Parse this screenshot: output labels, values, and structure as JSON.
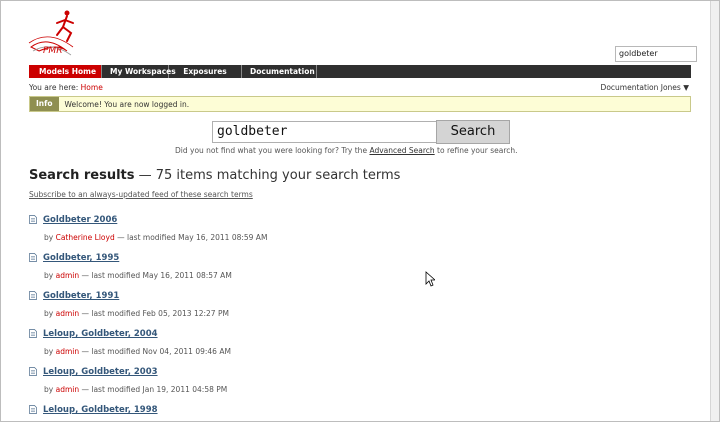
{
  "header": {
    "search_value": "goldbeter",
    "nav_tabs": [
      {
        "label": "Models Home",
        "active": true
      },
      {
        "label": "My Workspaces",
        "active": false
      },
      {
        "label": "Exposures",
        "active": false
      },
      {
        "label": "Documentation",
        "active": false
      }
    ],
    "breadcrumb_prefix": "You are here:",
    "breadcrumb_home": "Home",
    "user_name": "Documentation Jones",
    "user_menu_icon": "caret-down-icon"
  },
  "info": {
    "label": "Info",
    "message": "Welcome! You are now logged in."
  },
  "search": {
    "input_value": "goldbeter",
    "button_label": "Search",
    "hint_prefix": "Did you not find what you were looking for? Try the",
    "hint_link": "Advanced Search",
    "hint_suffix": "to refine your search."
  },
  "results": {
    "heading_bold": "Search results",
    "heading_rest": "— 75 items matching your search terms",
    "subscribe_link": "Subscribe to an always-updated feed of these search terms",
    "by_label": "by",
    "modified_label": "— last modified",
    "items": [
      {
        "title": "Goldbeter 2006",
        "author": "Catherine Lloyd",
        "modified": "May 16, 2011 08:59 AM"
      },
      {
        "title": "Goldbeter, 1995",
        "author": "admin",
        "modified": "May 16, 2011 08:57 AM"
      },
      {
        "title": "Goldbeter, 1991",
        "author": "admin",
        "modified": "Feb 05, 2013 12:27 PM"
      },
      {
        "title": "Leloup, Goldbeter, 2004",
        "author": "admin",
        "modified": "Nov 04, 2011 09:46 AM"
      },
      {
        "title": "Leloup, Goldbeter, 2003",
        "author": "admin",
        "modified": "Jan 19, 2011 04:58 PM"
      },
      {
        "title": "Leloup, Goldbeter, 1998",
        "author": "",
        "modified": ""
      }
    ]
  },
  "colors": {
    "accent": "#cc0000",
    "nav_bg": "#2f2f2f",
    "link": "#34577a",
    "info_bg": "#fdfdd6"
  }
}
